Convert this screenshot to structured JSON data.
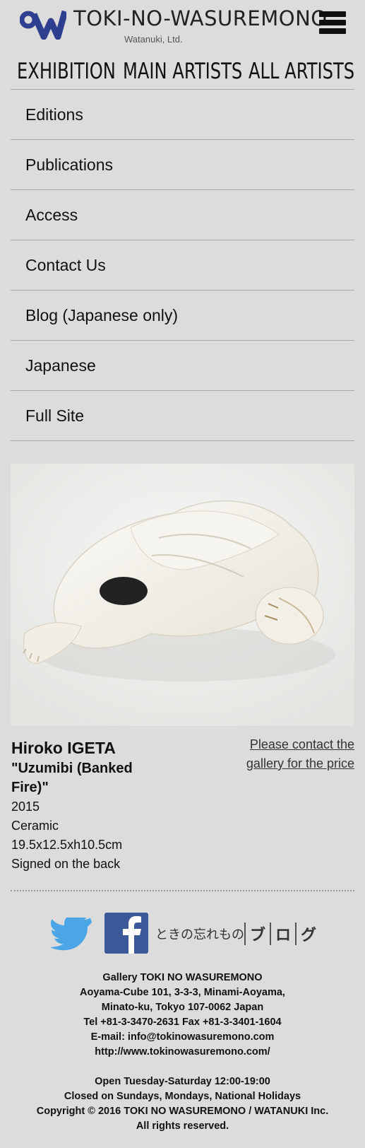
{
  "header": {
    "brand_title": "TOKI-NO-WASUREMONO",
    "brand_sub": "Watanuki, Ltd.",
    "logo_icon": "w-logo-icon",
    "menu_icon": "hamburger-icon"
  },
  "main_nav": [
    "EXHIBITION",
    "MAIN ARTISTS",
    "ALL ARTISTS"
  ],
  "menu": [
    "Editions",
    "Publications",
    "Access",
    "Contact Us",
    "Blog (Japanese only)",
    "Japanese",
    "Full Site"
  ],
  "artwork": {
    "artist": "Hiroko IGETA",
    "title": "\"Uzumibi (Banked Fire)\"",
    "year": "2015",
    "medium": "Ceramic",
    "size": "19.5x12.5xh10.5cm",
    "note": "Signed on the back",
    "price_link": "Please contact the gallery for the price"
  },
  "social": {
    "twitter_icon": "twitter-bird-icon",
    "facebook_icon": "facebook-icon",
    "blog_label": "ときの忘れもの",
    "blog_chars": [
      "ブ",
      "ロ",
      "グ"
    ]
  },
  "footer": {
    "lines": [
      "Gallery TOKI NO WASUREMONO",
      "Aoyama-Cube 101, 3-3-3, Minami-Aoyama,",
      "Minato-ku, Tokyo 107-0062 Japan",
      "Tel +81-3-3470-2631 Fax +81-3-3401-1604",
      "E-mail: info@tokinowasuremono.com",
      "http://www.tokinowasuremono.com/"
    ],
    "hours": [
      "Open Tuesday-Saturday 12:00-19:00",
      "Closed on Sundays, Mondays, National Holidays",
      "Copyright © 2016 TOKI NO WASUREMONO / WATANUKI Inc.",
      "All rights reserved."
    ]
  },
  "colors": {
    "background": "#dcdcdc",
    "logo_blue": "#2f3f8f",
    "facebook_blue": "#3b5998",
    "twitter_blue": "#4aa6e6"
  }
}
